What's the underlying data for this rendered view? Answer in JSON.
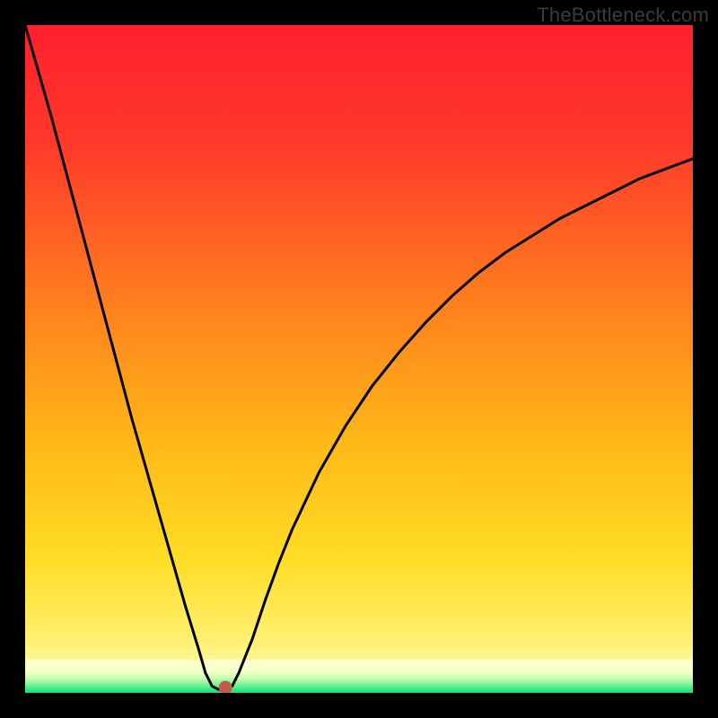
{
  "watermark": "TheBottleneck.com",
  "chart_data": {
    "type": "line",
    "title": "",
    "xlabel": "",
    "ylabel": "",
    "xlim": [
      0,
      100
    ],
    "ylim": [
      0,
      100
    ],
    "grid": false,
    "legend": false,
    "x": [
      0,
      2,
      4,
      6,
      8,
      10,
      12,
      14,
      16,
      18,
      20,
      22,
      24,
      26,
      27,
      28,
      29,
      30,
      31,
      32,
      34,
      36,
      38,
      40,
      44,
      48,
      52,
      56,
      60,
      64,
      68,
      72,
      76,
      80,
      84,
      88,
      92,
      96,
      100
    ],
    "values": [
      100,
      93,
      86,
      78.5,
      71,
      63.5,
      56,
      48.5,
      41,
      34,
      27,
      20,
      13,
      6.5,
      3,
      1,
      0.5,
      0.5,
      1,
      3,
      8,
      14,
      19.5,
      24.5,
      33,
      40,
      46,
      51,
      55.5,
      59.5,
      63,
      66,
      68.5,
      71,
      73,
      75,
      77,
      78.5,
      80
    ],
    "marker_point": {
      "x": 30,
      "y": 0
    },
    "bottom_band_ypct": [
      0,
      5
    ],
    "colors": {
      "top": "#ff1f2e",
      "mid": "#ffe030",
      "band_top": "#ffffd0",
      "band_bottom": "#00e676",
      "curve": "#000000",
      "marker": "#c05a4a"
    }
  }
}
